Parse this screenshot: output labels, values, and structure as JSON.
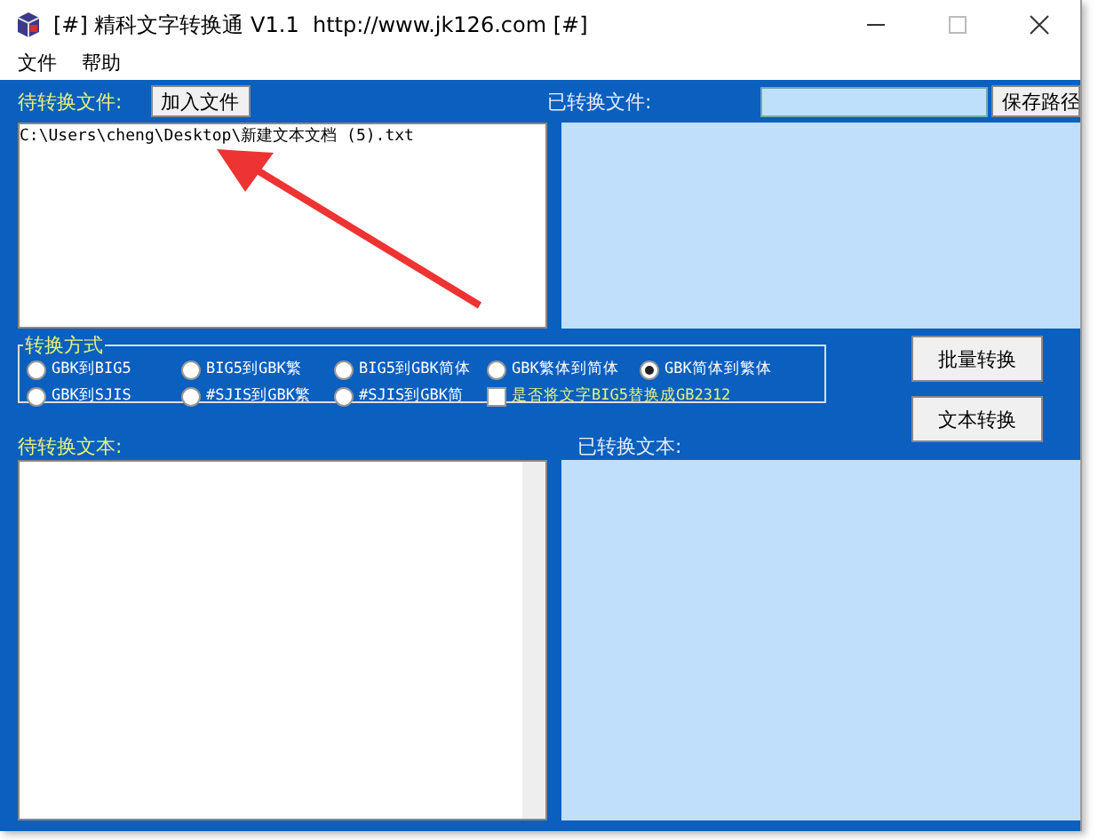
{
  "window": {
    "title": "[#] 精科文字转换通 V1.1  http://www.jk126.com [#]"
  },
  "menu": [
    "文件",
    "帮助"
  ],
  "source_files": {
    "label": "待转换文件:",
    "add_button": "加入文件",
    "items": [
      "C:\\Users\\cheng\\Desktop\\新建文本文档 (5).txt"
    ]
  },
  "converted_files": {
    "label": "已转换文件:",
    "save_button": "保存路径"
  },
  "mode_group": {
    "title": "转换方式",
    "options": [
      {
        "label": "GBK到BIG5",
        "selected": false
      },
      {
        "label": "BIG5到GBK繁",
        "selected": false
      },
      {
        "label": "BIG5到GBK简体",
        "selected": false
      },
      {
        "label": "GBK繁体到简体",
        "selected": false
      },
      {
        "label": "GBK简体到繁体",
        "selected": true
      },
      {
        "label": "GBK到SJIS",
        "selected": false
      },
      {
        "label": "#SJIS到GBK繁",
        "selected": false
      },
      {
        "label": "#SJIS到GBK简",
        "selected": false
      }
    ],
    "checkbox": {
      "label": "是否将文字BIG5替换成GB2312",
      "checked": false
    }
  },
  "buttons": [
    "批量转换",
    "文本转换"
  ],
  "source_text": {
    "label": "待转换文本:"
  },
  "converted_text": {
    "label": "已转换文本:"
  }
}
